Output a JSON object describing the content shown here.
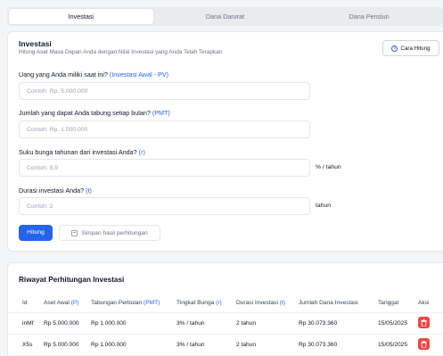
{
  "tabs": [
    {
      "label": "Investasi",
      "active": true
    },
    {
      "label": "Dana Darurat",
      "active": false
    },
    {
      "label": "Dana Pensiun",
      "active": false
    }
  ],
  "form": {
    "title": "Investasi",
    "subtitle": "Hitung Aset Masa Depan Anda dengan Nilai Investasi yang Anda Telah Terapkan",
    "how_label": "Cara Hitung",
    "fields": [
      {
        "label": "Uang yang Anda miliki saat ini?",
        "hint": "(Investasi Awal - PV)",
        "placeholder": "Contoh: Rp. 5.000.000",
        "suffix": ""
      },
      {
        "label": "Jumlah yang dapat Anda tabung setiap bulan?",
        "hint": "(PMT)",
        "placeholder": "Contoh: Rp. 1.000.000",
        "suffix": ""
      },
      {
        "label": "Suku bunga tahunan dari investasi Anda?",
        "hint": "(r)",
        "placeholder": "Contoh: 5,9",
        "suffix": "% / tahun"
      },
      {
        "label": "Durasi investasi Anda?",
        "hint": "(t)",
        "placeholder": "Contoh: 2",
        "suffix": "tahun"
      }
    ],
    "calc_label": "Hitung",
    "save_label": "Simpan hasil perhitungan"
  },
  "history": {
    "title": "Riwayat Perhitungan Investasi",
    "columns": [
      {
        "label": "Id",
        "hint": ""
      },
      {
        "label": "Aset Awal",
        "hint": "(P)"
      },
      {
        "label": "Tabungan Perbulan",
        "hint": "(PMT)"
      },
      {
        "label": "Tingkat Bunga",
        "hint": "(r)"
      },
      {
        "label": "Durasi Investasi",
        "hint": "(t)"
      },
      {
        "label": "Jumlah Dana Investasi",
        "hint": ""
      },
      {
        "label": "Tanggal",
        "hint": ""
      },
      {
        "label": "Aksi",
        "hint": ""
      }
    ],
    "rows": [
      {
        "id": "inMf",
        "p": "Rp 5.000.000",
        "pmt": "Rp 1.000.000",
        "r": "3% / tahun",
        "t": "2 tahun",
        "total": "Rp 30.073.360",
        "date": "15/05/2025"
      },
      {
        "id": "X5s",
        "p": "Rp 5.000.000",
        "pmt": "Rp 1.000.000",
        "r": "3% / tahun",
        "t": "2 tahun",
        "total": "Rp 30.073.360",
        "date": "15/05/2025"
      }
    ]
  },
  "icons": {
    "info": "info-icon",
    "save": "save-icon",
    "trash": "trash-icon"
  },
  "colors": {
    "accent": "#2563eb",
    "danger": "#ef4444"
  }
}
